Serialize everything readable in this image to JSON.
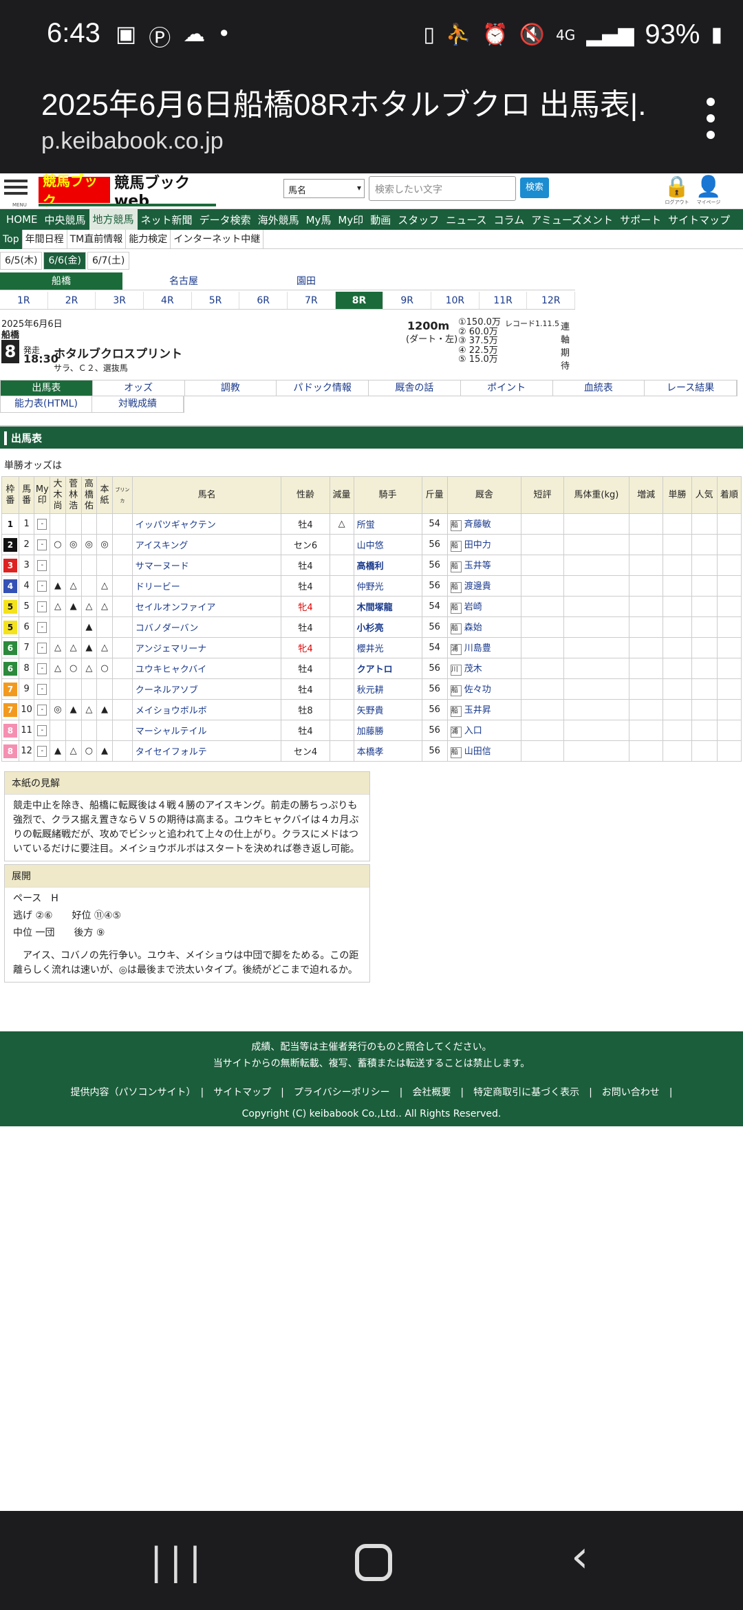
{
  "status": {
    "time": "6:43",
    "battery": "93%",
    "signal": "4G"
  },
  "browser": {
    "title": "2025年6月6日船橋08Rホタルブクロ 出馬表|...",
    "url": "p.keibabook.co.jp"
  },
  "header": {
    "logo_kanji": "競馬ブック",
    "logo_text": "競馬ブックweb",
    "select_value": "馬名",
    "search_placeholder": "検索したい文字",
    "search_button": "検索",
    "logout": "ログアウト",
    "mypage": "マイページ",
    "menu": "MENU"
  },
  "global_nav": [
    "HOME",
    "中央競馬",
    "地方競馬",
    "ネット新聞",
    "データ検索",
    "海外競馬",
    "My馬",
    "My印",
    "動画",
    "スタッフ",
    "ニュース",
    "コラム",
    "アミューズメント",
    "サポート",
    "サイトマップ"
  ],
  "sub_nav": [
    "Top",
    "年間日程",
    "TM直前情報",
    "能力検定",
    "インターネット中継"
  ],
  "days": [
    "6/5(木)",
    "6/6(金)",
    "6/7(土)"
  ],
  "venues": [
    "船橋",
    "名古屋",
    "園田"
  ],
  "races": [
    "1R",
    "2R",
    "3R",
    "4R",
    "5R",
    "6R",
    "7R",
    "8R",
    "9R",
    "10R",
    "11R",
    "12R"
  ],
  "race": {
    "date": "2025年6月6日",
    "venue": "船橋",
    "num": "8",
    "post_label": "発走",
    "post_time": "18:30",
    "name": "ホタルブクロスプリント",
    "cond": "サラ、Ｃ２、選抜馬",
    "distance": "1200m",
    "course": "(ダート・左)",
    "record": "レコード1.11.5",
    "prizes": [
      "①150.0万",
      "②  60.0万",
      "③  37.5万",
      "④  22.5万",
      "⑤  15.0万"
    ],
    "renjiku": [
      "連",
      "軸",
      "期",
      "待"
    ]
  },
  "tabs": [
    "出馬表",
    "オッズ",
    "調教",
    "パドック情報",
    "厩舎の話",
    "ポイント",
    "血統表",
    "レース結果"
  ],
  "tabs2": [
    "能力表(HTML)",
    "対戦成績"
  ],
  "section_title": "出馬表",
  "odds_note": "単勝オッズは",
  "columns": [
    "枠番",
    "馬番",
    "My印",
    "大木尚",
    "菅林浩",
    "高橋佑",
    "本紙",
    "ブリンカ",
    "馬名",
    "性齢",
    "減量",
    "騎手",
    "斤量",
    "厩舎",
    "短評",
    "馬体重(kg)",
    "増減",
    "単勝",
    "人気",
    "着順"
  ],
  "entries": [
    {
      "waku": "1",
      "num": "1",
      "m1": "",
      "m2": "",
      "m3": "",
      "m4": "",
      "name": "イッパツギャクテン",
      "sex": "牡4",
      "gen": "△",
      "jockey": "所蛍",
      "kin": "54",
      "area": "船",
      "trainer": "斉藤敏",
      "jb": false,
      "red": false
    },
    {
      "waku": "2",
      "num": "2",
      "m1": "○",
      "m2": "◎",
      "m3": "◎",
      "m4": "◎",
      "name": "アイスキング",
      "sex": "セン6",
      "gen": "",
      "jockey": "山中悠",
      "kin": "56",
      "area": "船",
      "trainer": "田中力",
      "jb": false,
      "red": false
    },
    {
      "waku": "3",
      "num": "3",
      "m1": "",
      "m2": "",
      "m3": "",
      "m4": "",
      "name": "サマーヌード",
      "sex": "牡4",
      "gen": "",
      "jockey": "高橋利",
      "kin": "56",
      "area": "船",
      "trainer": "玉井等",
      "jb": true,
      "red": false
    },
    {
      "waku": "4",
      "num": "4",
      "m1": "▲",
      "m2": "△",
      "m3": "",
      "m4": "△",
      "name": "ドリービー",
      "sex": "牡4",
      "gen": "",
      "jockey": "仲野光",
      "kin": "56",
      "area": "船",
      "trainer": "渡邊貴",
      "jb": false,
      "red": false
    },
    {
      "waku": "5",
      "num": "5",
      "m1": "△",
      "m2": "▲",
      "m3": "△",
      "m4": "△",
      "name": "セイルオンファイア",
      "sex": "牝4",
      "gen": "",
      "jockey": "木間塚龍",
      "kin": "54",
      "area": "船",
      "trainer": "岩崎",
      "jb": true,
      "red": true
    },
    {
      "waku": "5",
      "num": "6",
      "m1": "",
      "m2": "",
      "m3": "▲",
      "m4": "",
      "name": "コバノダーバン",
      "sex": "牡4",
      "gen": "",
      "jockey": "小杉亮",
      "kin": "56",
      "area": "船",
      "trainer": "森始",
      "jb": true,
      "red": false
    },
    {
      "waku": "6",
      "num": "7",
      "m1": "△",
      "m2": "△",
      "m3": "▲",
      "m4": "△",
      "name": "アンジェマリーナ",
      "sex": "牝4",
      "gen": "",
      "jockey": "櫻井光",
      "kin": "54",
      "area": "浦",
      "trainer": "川島豊",
      "jb": false,
      "red": true
    },
    {
      "waku": "6",
      "num": "8",
      "m1": "△",
      "m2": "○",
      "m3": "△",
      "m4": "○",
      "name": "ユウキヒャクバイ",
      "sex": "牡4",
      "gen": "",
      "jockey": "クアトロ",
      "kin": "56",
      "area": "川",
      "trainer": "茂木",
      "jb": true,
      "red": false
    },
    {
      "waku": "7",
      "num": "9",
      "m1": "",
      "m2": "",
      "m3": "",
      "m4": "",
      "name": "クーネルアソブ",
      "sex": "牡4",
      "gen": "",
      "jockey": "秋元耕",
      "kin": "56",
      "area": "船",
      "trainer": "佐々功",
      "jb": false,
      "red": false
    },
    {
      "waku": "7",
      "num": "10",
      "m1": "◎",
      "m2": "▲",
      "m3": "△",
      "m4": "▲",
      "name": "メイショウボルボ",
      "sex": "牡8",
      "gen": "",
      "jockey": "矢野貴",
      "kin": "56",
      "area": "船",
      "trainer": "玉井昇",
      "jb": false,
      "red": false
    },
    {
      "waku": "8",
      "num": "11",
      "m1": "",
      "m2": "",
      "m3": "",
      "m4": "",
      "name": "マーシャルテイル",
      "sex": "牡4",
      "gen": "",
      "jockey": "加藤勝",
      "kin": "56",
      "area": "浦",
      "trainer": "入口",
      "jb": false,
      "red": false
    },
    {
      "waku": "8",
      "num": "12",
      "m1": "▲",
      "m2": "△",
      "m3": "○",
      "m4": "▲",
      "name": "タイセイフォルテ",
      "sex": "セン4",
      "gen": "",
      "jockey": "本橋孝",
      "kin": "56",
      "area": "船",
      "trainer": "山田信",
      "jb": false,
      "red": false
    }
  ],
  "waku_colors": {
    "1": "#ffffff",
    "2": "#111111",
    "3": "#d22",
    "4": "#3451b5",
    "5": "#f4e21c",
    "6": "#2c8a3c",
    "7": "#f29a1f",
    "8": "#f58fb2"
  },
  "kenkai": {
    "title": "本紙の見解",
    "text": "競走中止を除き、船橋に転厩後は４戦４勝のアイスキング。前走の勝ちっぷりも強烈で、クラス据え置きならＶ５の期待は高まる。ユウキヒャクバイは４カ月ぶりの転厩緒戦だが、攻めでビシッと追われて上々の仕上がり。クラスにメドはついているだけに要注目。メイショウボルボはスタートを決めれば巻き返し可能。"
  },
  "tenkai": {
    "title": "展開",
    "pace": "ペース　H",
    "lines": [
      "逃げ ②⑥　　好位 ⑪④⑤",
      "中位 一団　　後方 ⑨"
    ],
    "text": "　アイス、コバノの先行争い。ユウキ、メイショウは中団で脚をためる。この距離らしく流れは速いが、◎は最後まで渋太いタイプ。後続がどこまで迫れるか。"
  },
  "footer": {
    "line1": "成績、配当等は主催者発行のものと照合してください。",
    "line2": "当サイトからの無断転載、複写、蓄積または転送することは禁止します。",
    "links": [
      "提供内容（パソコンサイト）",
      "サイトマップ",
      "プライバシーポリシー",
      "会社概要",
      "特定商取引に基づく表示",
      "お問い合わせ"
    ],
    "copyright": "Copyright (C) keibabook Co.,Ltd.. All Rights Reserved."
  }
}
